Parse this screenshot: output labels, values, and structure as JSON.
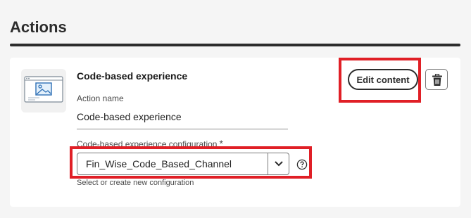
{
  "section": {
    "title": "Actions"
  },
  "card": {
    "title": "Code-based experience",
    "thumbnail_icon": "image-placeholder-icon",
    "action_name": {
      "label": "Action name",
      "value": "Code-based experience"
    },
    "configuration": {
      "label": "Code-based experience configuration",
      "required_marker": "*",
      "selected": "Fin_Wise_Code_Based_Channel",
      "helper_text": "Select or create new configuration"
    },
    "edit_button_label": "Edit content",
    "icons": {
      "delete": "trash-icon",
      "dropdown": "chevron-down-icon",
      "help": "help-circle-icon"
    }
  },
  "colors": {
    "highlight": "#e01f26",
    "text_dark": "#2c2c2c",
    "page_background": "#f5f5f5",
    "card_background": "#ffffff"
  }
}
